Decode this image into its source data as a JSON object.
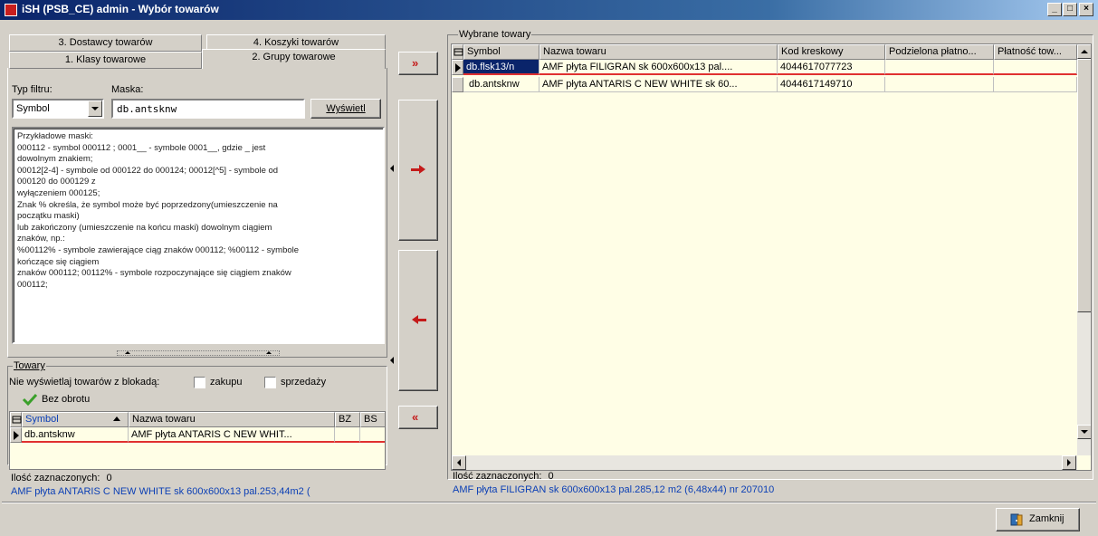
{
  "window": {
    "title": "iSH (PSB_CE) admin - Wybór towarów",
    "controls": [
      "_",
      "□",
      "×"
    ]
  },
  "tabs": {
    "row_back": [
      "3. Dostawcy towarów",
      "4. Koszyki towarów"
    ],
    "row_front": [
      "1. Klasy towarowe",
      "2. Grupy towarowe"
    ],
    "active": "2. Grupy towarowe"
  },
  "filter": {
    "type_label": "Typ filtru:",
    "type_value": "Symbol",
    "mask_label": "Maska:",
    "mask_value": "db.antsknw",
    "show_button": "Wyświetl"
  },
  "help_text": [
    "Przykładowe maski:",
    "000112 - symbol 000112 ; 0001__ - symbole 0001__, gdzie _ jest",
    "dowolnym znakiem;",
    "00012[2-4] - symbole od 000122 do 000124;  00012[^5] - symbole od",
    "000120 do 000129 z",
    "wyłączeniem 000125;",
    "Znak % określa, że symbol może być poprzedzony(umieszczenie na",
    "początku maski)",
    "lub zakończony (umieszczenie na końcu maski) dowolnym ciągiem",
    "znaków, np.:",
    "%00112% - symbole zawierające ciąg znaków 000112; %00112 - symbole",
    "kończące się ciągiem",
    "znaków 000112; 00112% - symbole rozpoczynające się ciągiem znaków",
    "000112;"
  ],
  "towary": {
    "group_label": "Towary",
    "blokada_label": "Nie wyświetlaj towarów z blokadą:",
    "zakupu_label": "zakupu",
    "sprzedazy_label": "sprzedaży",
    "bez_obrotu_label": "Bez obrotu",
    "columns": [
      "Symbol",
      "Nazwa towaru",
      "BZ",
      "BS"
    ],
    "rows": [
      {
        "symbol": "db.antsknw",
        "nazwa": "AMF płyta ANTARIS C NEW WHIT...",
        "bz": "",
        "bs": ""
      }
    ],
    "count_label": "Ilość zaznaczonych:",
    "count_value": "0",
    "status_line": "AMF płyta ANTARIS C NEW WHITE sk 600x600x13 pal.253,44m2  ("
  },
  "transfer_buttons": {
    "add_all": "»",
    "add_one": "→",
    "remove_one": "←",
    "remove_all": "«"
  },
  "selected": {
    "group_label": "Wybrane towary",
    "columns": [
      "Symbol",
      "Nazwa towaru",
      "Kod kreskowy",
      "Podzielona płatno...",
      "Płatność tow..."
    ],
    "rows": [
      {
        "symbol": "db.flsk13/n",
        "nazwa": "AMF płyta FILIGRAN sk 600x600x13   pal....",
        "kod": "4044617077723",
        "podzielona": "",
        "platnosc": ""
      },
      {
        "symbol": "db.antsknw",
        "nazwa": "AMF płyta ANTARIS C NEW WHITE sk 60...",
        "kod": "4044617149710",
        "podzielona": "",
        "platnosc": ""
      }
    ],
    "count_label": "Ilość zaznaczonych:",
    "count_value": "0",
    "status_line": "AMF płyta FILIGRAN sk 600x600x13   pal.285,12 m2   (6,48x44)   nr 207010"
  },
  "close_button": "Zamknij",
  "colors": {
    "titlebar": "#0a246a",
    "grid_bg": "#fffee6",
    "selected_cell": "#0a246a",
    "status_text": "#0b3fb5",
    "arrow": "#c41a1a",
    "row_underline": "#e03030"
  }
}
